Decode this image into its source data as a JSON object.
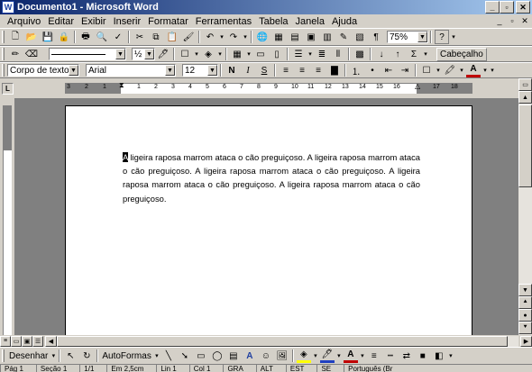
{
  "window": {
    "title": "Documento1 - Microsoft Word"
  },
  "menu": [
    "Arquivo",
    "Editar",
    "Exibir",
    "Inserir",
    "Formatar",
    "Ferramentas",
    "Tabela",
    "Janela",
    "Ajuda"
  ],
  "toolbar_standard": {
    "zoom": "75%",
    "help_icon": "?"
  },
  "toolbar_format": {
    "style": "Corpo de texto",
    "font": "Arial",
    "size": "12",
    "bold": "N",
    "italic": "I",
    "underline": "S",
    "header_button": "Cabeçalho",
    "line_width": "½"
  },
  "ruler_numbers": [
    "3",
    "2",
    "1",
    "1",
    "2",
    "3",
    "4",
    "5",
    "6",
    "7",
    "8",
    "9",
    "10",
    "11",
    "12",
    "13",
    "14",
    "15",
    "16",
    "17",
    "18"
  ],
  "document": {
    "cursor_char": "A",
    "text": " ligeira raposa marrom ataca o cão preguiçoso. A ligeira raposa marrom ataca o cão preguiçoso. A ligeira raposa marrom ataca o cão preguiçoso. A ligeira raposa marrom ataca o cão preguiçoso. A ligeira raposa marrom ataca o cão preguiçoso."
  },
  "drawing_toolbar": {
    "draw": "Desenhar",
    "autoshapes": "AutoFormas"
  },
  "status": [
    "Pág 1",
    "Seção 1",
    "1/1",
    "Em 2,5cm",
    "Lin 1",
    "Col 1",
    "GRA",
    "ALT",
    "EST",
    "SE",
    "Português (Br"
  ]
}
